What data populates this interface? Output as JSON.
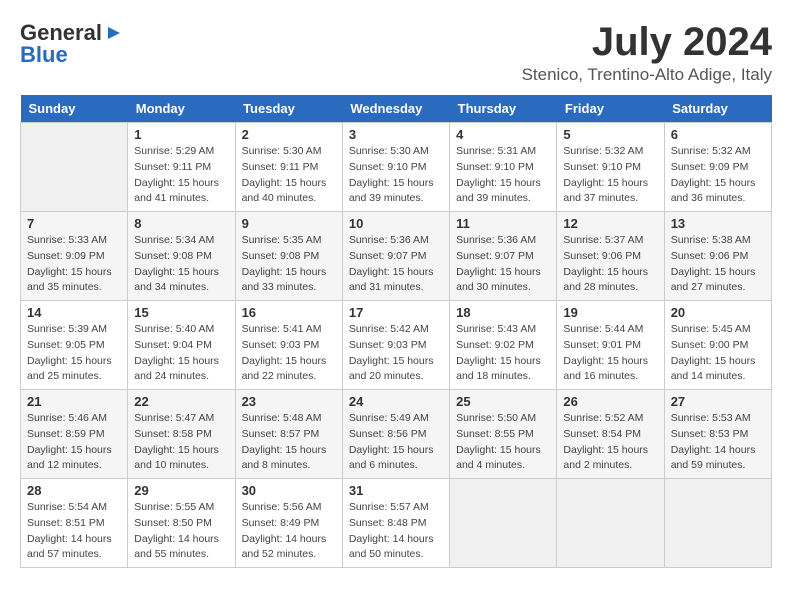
{
  "header": {
    "logo_line1": "General",
    "logo_line2": "Blue",
    "month": "July 2024",
    "location": "Stenico, Trentino-Alto Adige, Italy"
  },
  "days_of_week": [
    "Sunday",
    "Monday",
    "Tuesday",
    "Wednesday",
    "Thursday",
    "Friday",
    "Saturday"
  ],
  "weeks": [
    [
      {
        "day": "",
        "empty": true
      },
      {
        "day": "1",
        "sunrise": "5:29 AM",
        "sunset": "9:11 PM",
        "daylight": "15 hours and 41 minutes."
      },
      {
        "day": "2",
        "sunrise": "5:30 AM",
        "sunset": "9:11 PM",
        "daylight": "15 hours and 40 minutes."
      },
      {
        "day": "3",
        "sunrise": "5:30 AM",
        "sunset": "9:10 PM",
        "daylight": "15 hours and 39 minutes."
      },
      {
        "day": "4",
        "sunrise": "5:31 AM",
        "sunset": "9:10 PM",
        "daylight": "15 hours and 39 minutes."
      },
      {
        "day": "5",
        "sunrise": "5:32 AM",
        "sunset": "9:10 PM",
        "daylight": "15 hours and 37 minutes."
      },
      {
        "day": "6",
        "sunrise": "5:32 AM",
        "sunset": "9:09 PM",
        "daylight": "15 hours and 36 minutes."
      }
    ],
    [
      {
        "day": "7",
        "sunrise": "5:33 AM",
        "sunset": "9:09 PM",
        "daylight": "15 hours and 35 minutes."
      },
      {
        "day": "8",
        "sunrise": "5:34 AM",
        "sunset": "9:08 PM",
        "daylight": "15 hours and 34 minutes."
      },
      {
        "day": "9",
        "sunrise": "5:35 AM",
        "sunset": "9:08 PM",
        "daylight": "15 hours and 33 minutes."
      },
      {
        "day": "10",
        "sunrise": "5:36 AM",
        "sunset": "9:07 PM",
        "daylight": "15 hours and 31 minutes."
      },
      {
        "day": "11",
        "sunrise": "5:36 AM",
        "sunset": "9:07 PM",
        "daylight": "15 hours and 30 minutes."
      },
      {
        "day": "12",
        "sunrise": "5:37 AM",
        "sunset": "9:06 PM",
        "daylight": "15 hours and 28 minutes."
      },
      {
        "day": "13",
        "sunrise": "5:38 AM",
        "sunset": "9:06 PM",
        "daylight": "15 hours and 27 minutes."
      }
    ],
    [
      {
        "day": "14",
        "sunrise": "5:39 AM",
        "sunset": "9:05 PM",
        "daylight": "15 hours and 25 minutes."
      },
      {
        "day": "15",
        "sunrise": "5:40 AM",
        "sunset": "9:04 PM",
        "daylight": "15 hours and 24 minutes."
      },
      {
        "day": "16",
        "sunrise": "5:41 AM",
        "sunset": "9:03 PM",
        "daylight": "15 hours and 22 minutes."
      },
      {
        "day": "17",
        "sunrise": "5:42 AM",
        "sunset": "9:03 PM",
        "daylight": "15 hours and 20 minutes."
      },
      {
        "day": "18",
        "sunrise": "5:43 AM",
        "sunset": "9:02 PM",
        "daylight": "15 hours and 18 minutes."
      },
      {
        "day": "19",
        "sunrise": "5:44 AM",
        "sunset": "9:01 PM",
        "daylight": "15 hours and 16 minutes."
      },
      {
        "day": "20",
        "sunrise": "5:45 AM",
        "sunset": "9:00 PM",
        "daylight": "15 hours and 14 minutes."
      }
    ],
    [
      {
        "day": "21",
        "sunrise": "5:46 AM",
        "sunset": "8:59 PM",
        "daylight": "15 hours and 12 minutes."
      },
      {
        "day": "22",
        "sunrise": "5:47 AM",
        "sunset": "8:58 PM",
        "daylight": "15 hours and 10 minutes."
      },
      {
        "day": "23",
        "sunrise": "5:48 AM",
        "sunset": "8:57 PM",
        "daylight": "15 hours and 8 minutes."
      },
      {
        "day": "24",
        "sunrise": "5:49 AM",
        "sunset": "8:56 PM",
        "daylight": "15 hours and 6 minutes."
      },
      {
        "day": "25",
        "sunrise": "5:50 AM",
        "sunset": "8:55 PM",
        "daylight": "15 hours and 4 minutes."
      },
      {
        "day": "26",
        "sunrise": "5:52 AM",
        "sunset": "8:54 PM",
        "daylight": "15 hours and 2 minutes."
      },
      {
        "day": "27",
        "sunrise": "5:53 AM",
        "sunset": "8:53 PM",
        "daylight": "14 hours and 59 minutes."
      }
    ],
    [
      {
        "day": "28",
        "sunrise": "5:54 AM",
        "sunset": "8:51 PM",
        "daylight": "14 hours and 57 minutes."
      },
      {
        "day": "29",
        "sunrise": "5:55 AM",
        "sunset": "8:50 PM",
        "daylight": "14 hours and 55 minutes."
      },
      {
        "day": "30",
        "sunrise": "5:56 AM",
        "sunset": "8:49 PM",
        "daylight": "14 hours and 52 minutes."
      },
      {
        "day": "31",
        "sunrise": "5:57 AM",
        "sunset": "8:48 PM",
        "daylight": "14 hours and 50 minutes."
      },
      {
        "day": "",
        "empty": true
      },
      {
        "day": "",
        "empty": true
      },
      {
        "day": "",
        "empty": true
      }
    ]
  ]
}
